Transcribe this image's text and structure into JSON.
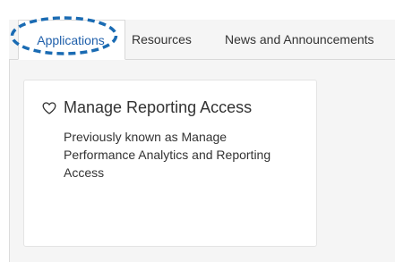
{
  "tabs": [
    {
      "label": "Applications",
      "active": true
    },
    {
      "label": "Resources",
      "active": false
    },
    {
      "label": "News and Announcements",
      "active": false
    }
  ],
  "card": {
    "icon": "heart-outline-icon",
    "title": "Manage Reporting Access",
    "description": "Previously known as Manage Performance Analytics and Reporting Access"
  },
  "colors": {
    "active_tab_text": "#1f5faa",
    "highlight_ring": "#1a6bb3",
    "frame_background": "#f5f5f5",
    "card_background": "#ffffff"
  }
}
